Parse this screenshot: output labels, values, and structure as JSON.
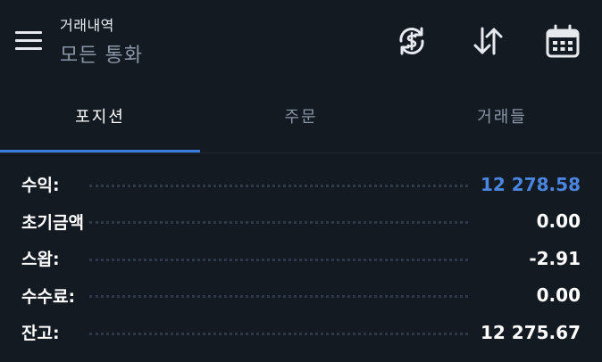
{
  "header": {
    "subtitle": "거래내역",
    "title": "모든 통화",
    "icons": [
      "currency-exchange-icon",
      "sort-arrows-icon",
      "calendar-icon"
    ]
  },
  "tabs": [
    {
      "label": "포지션",
      "active": true
    },
    {
      "label": "주문",
      "active": false
    },
    {
      "label": "거래들",
      "active": false
    }
  ],
  "summary": [
    {
      "label": "수익:",
      "value": "12 278.58",
      "accent": true
    },
    {
      "label": "초기금액",
      "value": "0.00",
      "accent": false
    },
    {
      "label": "스왑:",
      "value": "-2.91",
      "accent": false
    },
    {
      "label": "수수료:",
      "value": "0.00",
      "accent": false
    },
    {
      "label": "잔고:",
      "value": "12 275.67",
      "accent": false
    }
  ],
  "colors": {
    "background": "#131a22",
    "accent": "#4a86e0",
    "tab_underline": "#3b7ddd",
    "muted_text": "#8a96a6"
  }
}
